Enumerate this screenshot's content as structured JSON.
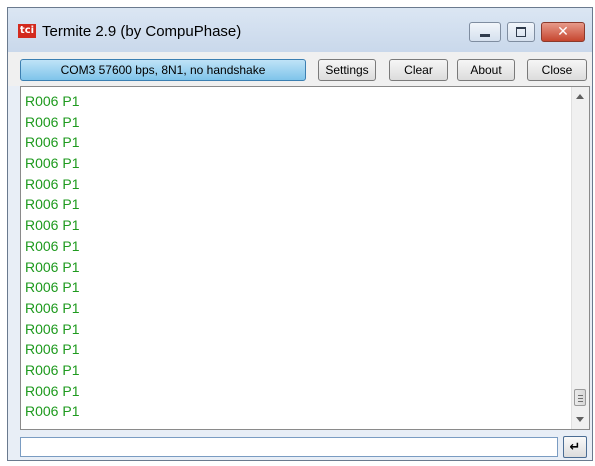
{
  "window": {
    "title": "Termite 2.9 (by CompuPhase)",
    "icon": "termite-app-icon"
  },
  "toolbar": {
    "port_label": "COM3 57600 bps, 8N1, no handshake",
    "settings_label": "Settings",
    "clear_label": "Clear",
    "about_label": "About",
    "close_label": "Close"
  },
  "terminal": {
    "text_color": "#1e9a1e",
    "lines": [
      "R006 P1",
      "R006 P1",
      "R006 P1",
      "R006 P1",
      "R006 P1",
      "R006 P1",
      "R006 P1",
      "R006 P1",
      "R006 P1",
      "R006 P1",
      "R006 P1",
      "R006 P1",
      "R006 P1",
      "R006 P1",
      "R006 P1",
      "R006 P1"
    ]
  },
  "input": {
    "value": "",
    "send_icon": "enter-icon"
  }
}
